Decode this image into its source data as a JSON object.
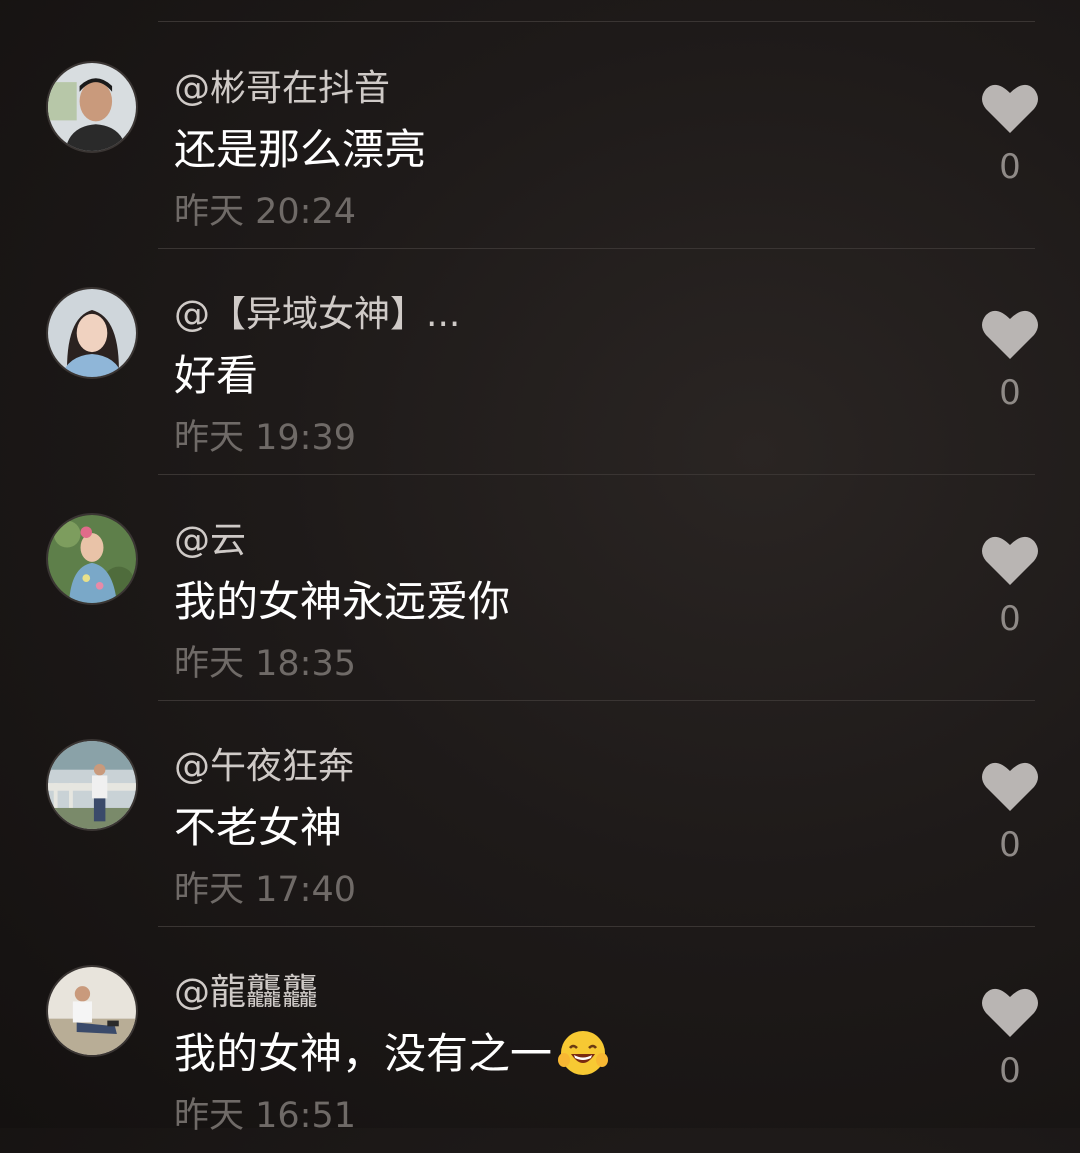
{
  "comments": [
    {
      "username": "@彬哥在抖音",
      "text": "还是那么漂亮",
      "time": "昨天 20:24",
      "likes": "0",
      "avatar": "man-avatar-icon"
    },
    {
      "username": "@【异域女神】...",
      "text": "好看",
      "time": "昨天 19:39",
      "likes": "0",
      "avatar": "woman-avatar-icon"
    },
    {
      "username": "@云",
      "text": "我的女神永远爱你",
      "time": "昨天 18:35",
      "likes": "0",
      "avatar": "flower-woman-avatar-icon"
    },
    {
      "username": "@午夜狂奔",
      "text": "不老女神",
      "time": "昨天 17:40",
      "likes": "0",
      "avatar": "standing-man-avatar-icon"
    },
    {
      "username": "@龍龘龘",
      "text": "我的女神，没有之一",
      "time": "昨天 16:51",
      "likes": "0",
      "avatar": "sitting-man-avatar-icon",
      "emoji": "grinning-emoji-icon"
    }
  ],
  "colors": {
    "background": "#1e1a19",
    "username": "#cfcac7",
    "text": "#ffffff",
    "time": "#6f6a67",
    "heart": "#b9b5b3"
  }
}
